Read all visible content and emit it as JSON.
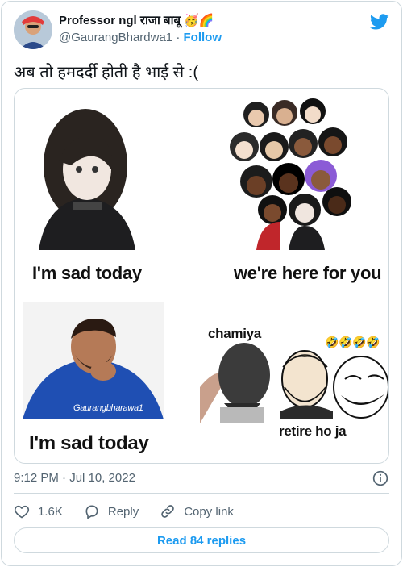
{
  "user": {
    "name": "Professor ngl राजा बाबू 🥳🌈",
    "handle": "@GaurangBhardwa1",
    "separator": "·",
    "follow_label": "Follow"
  },
  "tweet": {
    "text": "अब तो हमदर्दी होती है भाई से :("
  },
  "meme": {
    "panel1_caption": "I'm sad today",
    "panel2_caption": "we're here for you",
    "panel3_caption": "I'm sad today",
    "panel3_watermark": "Gaurangbharawa1",
    "panel4_top_label": "chamiya",
    "panel4_emojis": "🤣🤣🤣🤣",
    "panel4_bottom_label": "retire ho ja"
  },
  "meta": {
    "timestamp": "9:12 PM · Jul 10, 2022"
  },
  "actions": {
    "likes": "1.6K",
    "reply_label": "Reply",
    "copy_label": "Copy link"
  },
  "footer": {
    "read_replies": "Read 84 replies"
  },
  "colors": {
    "accent": "#1d9bf0",
    "text_primary": "#0f1419",
    "text_secondary": "#536471",
    "border": "#cfd9de"
  },
  "icons": {
    "logo": "twitter-bird-icon",
    "info": "info-icon",
    "like": "heart-icon",
    "reply": "reply-bubble-icon",
    "copy": "link-icon"
  }
}
